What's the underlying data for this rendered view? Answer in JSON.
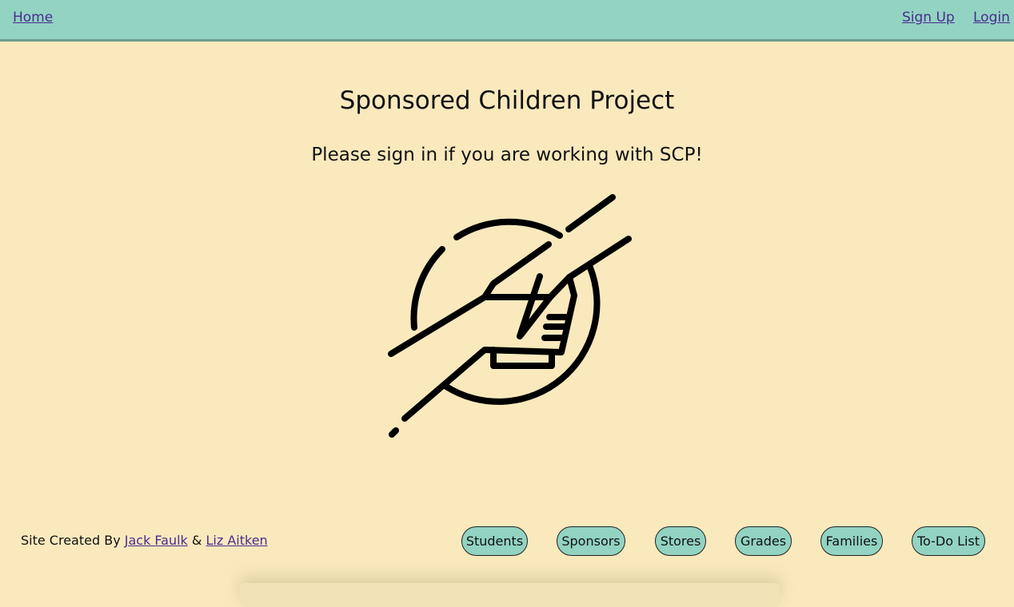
{
  "nav": {
    "home": "Home",
    "sign_up": "Sign Up",
    "login": "Login"
  },
  "main": {
    "title": "Sponsored Children Project",
    "subtitle": "Please sign in if you are working with SCP!"
  },
  "footer": {
    "credit_prefix": "Site Created By",
    "author1": "Jack Faulk",
    "separator": "&",
    "author2": "Liz Aitken",
    "buttons": [
      "Students",
      "Sponsors",
      "Stores",
      "Grades",
      "Families",
      "To-Do List"
    ]
  },
  "colors": {
    "background": "#f9e9bd",
    "navbar": "#92d3c2",
    "button": "#92d3c2",
    "link": "#4b2c8f"
  },
  "icons": {
    "logo": "helping-hands-icon"
  }
}
